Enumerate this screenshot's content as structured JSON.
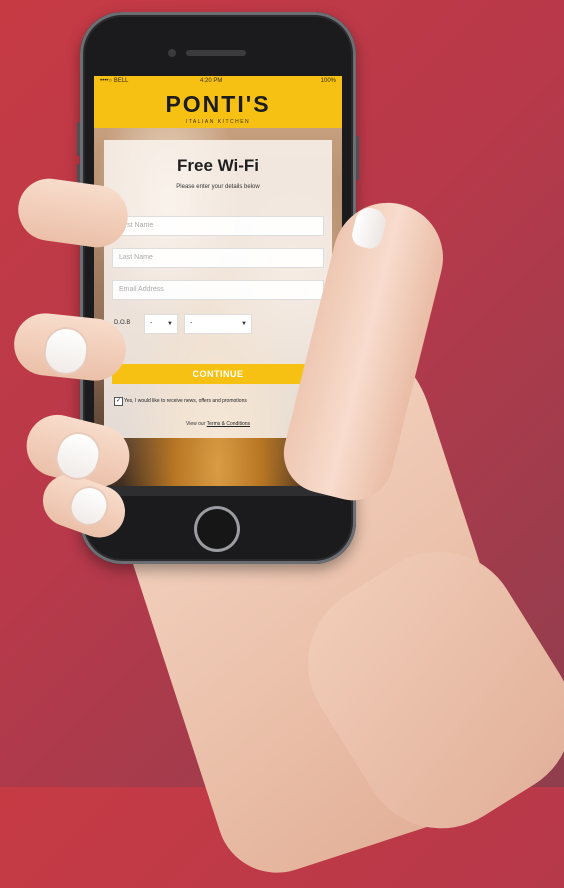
{
  "status_bar": {
    "carrier": "••••○ BELL",
    "time": "4:20 PM",
    "battery": "100%"
  },
  "brand": {
    "name": "PONTI'S",
    "tagline": "ITALIAN KITCHEN",
    "color": "#f7c114"
  },
  "form": {
    "title": "Free Wi-Fi",
    "subtitle": "Please enter your details below",
    "first_name_placeholder": "First Name",
    "last_name_placeholder": "Last Name",
    "email_placeholder": "Email Address",
    "dob_label_line1": "D.O.B",
    "dob_label_line2": "",
    "dob_day": "-",
    "dob_month": "-",
    "continue_label": "CONTINUE",
    "optin_check": "✓",
    "optin_text": "Yes, I would like to receive news, offers and promotions",
    "terms_prefix": "View our",
    "terms_link": "Terms & Conditions"
  },
  "icons": {
    "dropdown": "▼"
  }
}
